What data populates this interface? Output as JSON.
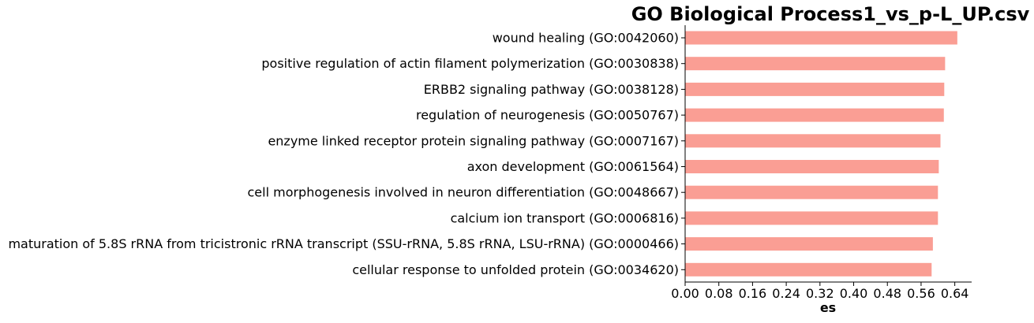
{
  "chart_data": {
    "type": "bar",
    "orientation": "horizontal",
    "title": "GO Biological Process1_vs_p-L_UP.csv",
    "xlabel": "es",
    "ylabel": "",
    "categories": [
      "wound healing (GO:0042060)",
      "positive regulation of actin filament polymerization (GO:0030838)",
      "ERBB2 signaling pathway (GO:0038128)",
      "regulation of neurogenesis (GO:0050767)",
      "enzyme linked receptor protein signaling pathway (GO:0007167)",
      "axon development (GO:0061564)",
      "cell morphogenesis involved in neuron differentiation (GO:0048667)",
      "calcium ion transport (GO:0006816)",
      "maturation of 5.8S rRNA from tricistronic rRNA transcript (SSU-rRNA, 5.8S rRNA, LSU-rRNA) (GO:0000466)",
      "cellular response to unfolded protein (GO:0034620)"
    ],
    "values": [
      0.646,
      0.617,
      0.615,
      0.614,
      0.606,
      0.602,
      0.6,
      0.6,
      0.588,
      0.585
    ],
    "xlim": [
      0,
      0.68
    ],
    "xticks": [
      0.0,
      0.08,
      0.16,
      0.24,
      0.32,
      0.4,
      0.48,
      0.56,
      0.64
    ],
    "xtick_labels": [
      "0.00",
      "0.08",
      "0.16",
      "0.24",
      "0.32",
      "0.40",
      "0.48",
      "0.56",
      "0.64"
    ],
    "bar_color": "#fa9e94",
    "axis_color": "#000000",
    "grid": false,
    "legend": false,
    "spines": "left and bottom only"
  }
}
